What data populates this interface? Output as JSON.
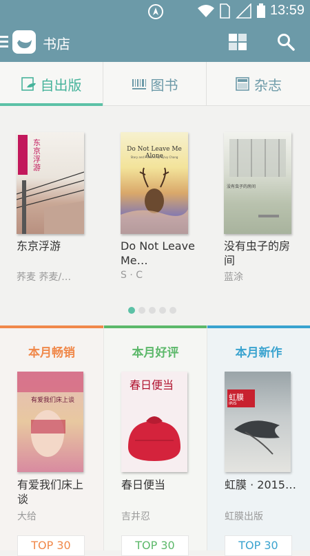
{
  "status_bar": {
    "time": "13:59"
  },
  "app_bar": {
    "title": "书店"
  },
  "tabs": [
    {
      "label": "自出版",
      "icon": "self-publish-icon",
      "active": true
    },
    {
      "label": "图书",
      "icon": "barcode-icon",
      "active": false
    },
    {
      "label": "杂志",
      "icon": "magazine-icon",
      "active": false
    }
  ],
  "carousel": {
    "books": [
      {
        "title": "东京浮游",
        "author": "荞麦  荞麦/…",
        "cover_text": "东京浮游"
      },
      {
        "title": "Do Not Leave Me…",
        "author": "S · C",
        "cover_text": "Do Not Leave Me Alone",
        "cover_sub": "Story and Pictures by Sylvy Chang"
      },
      {
        "title": "没有虫子的房间",
        "author": "蓝涂",
        "cover_text": "没有虫子的房间"
      }
    ],
    "page_count": 5,
    "active_page": 0
  },
  "columns": [
    {
      "title": "本月畅销",
      "color": "#f0884a",
      "book_title": "有爱我们床上谈",
      "author": "大给",
      "button": "TOP 30",
      "cover_text": "有爱我们床上谈"
    },
    {
      "title": "本月好评",
      "color": "#5cb86a",
      "book_title": "春日便当",
      "author": "吉井忍",
      "button": "TOP 30",
      "cover_text": "春日便当"
    },
    {
      "title": "本月新作",
      "color": "#3aa3cf",
      "book_title": "虹膜 · 2015…",
      "author": "虹膜出版",
      "button": "TOP 30",
      "cover_text": "虹膜",
      "cover_sub": "IRIS"
    }
  ],
  "colors": {
    "header": "#6c9aa8",
    "accent": "#5cc1a6"
  }
}
